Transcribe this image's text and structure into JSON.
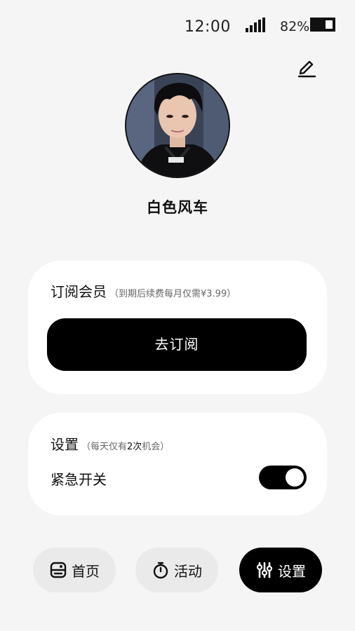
{
  "status_bar": {
    "time": "12:00",
    "battery_percent": "82%",
    "battery_level": 0.82,
    "signal_icon": "signal-bars-icon",
    "battery_icon": "battery-icon"
  },
  "header": {
    "edit_icon": "pencil-icon"
  },
  "profile": {
    "nickname": "白色风车",
    "avatar_icon": "avatar"
  },
  "subscription": {
    "title": "订阅会员",
    "hint": "（到期后续费每月仅需¥3.99）",
    "button_label": "去订阅"
  },
  "settings": {
    "title": "设置",
    "hint_prefix": "（每天仅有",
    "hint_emphasis": "2次",
    "hint_suffix": "机会）",
    "emergency_label": "紧急开关",
    "emergency_on": true
  },
  "tabs": [
    {
      "label": "首页",
      "icon": "home-icon",
      "active": false
    },
    {
      "label": "活动",
      "icon": "stopwatch-icon",
      "active": false
    },
    {
      "label": "设置",
      "icon": "sliders-icon",
      "active": true
    }
  ],
  "colors": {
    "background": "#f5f5f5",
    "card": "#ffffff",
    "accent": "#000000",
    "inactive_tab": "#eaeaea"
  }
}
